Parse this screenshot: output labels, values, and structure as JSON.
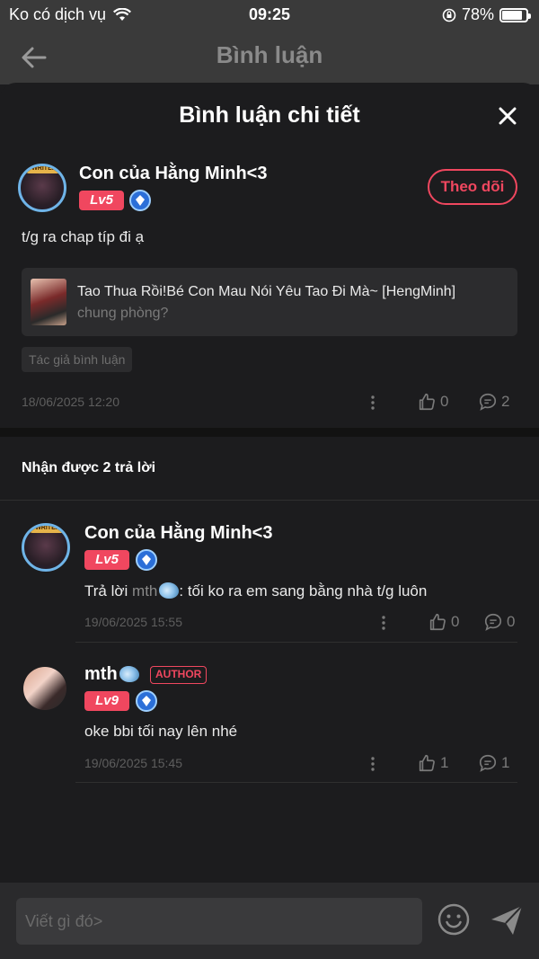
{
  "status_bar": {
    "carrier": "Ko có dịch vụ",
    "time": "09:25",
    "battery": "78%"
  },
  "header": {
    "title": "Bình luận"
  },
  "sheet": {
    "title": "Bình luận chi tiết"
  },
  "comment": {
    "user_name": "Con của Hằng Minh<3",
    "level": "Lv5",
    "follow_label": "Theo dõi",
    "text": "t/g ra chap típ đi ạ",
    "book_title": "Tao Thua Rồi!Bé Con Mau Nói Yêu Tao Đi Mà~ [HengMinh]",
    "book_subtitle": "chung phòng?",
    "tag": "Tác giả bình luận",
    "date": "18/06/2025 12:20",
    "likes": "0",
    "replies": "2"
  },
  "replies_header": "Nhận được 2 trả lời",
  "replies": [
    {
      "user_name": "Con của Hằng Minh<3",
      "level": "Lv5",
      "reply_prefix": "Trả lời ",
      "mention": "mth",
      "text": ": tối ko ra em sang bằng nhà t/g luôn",
      "date": "19/06/2025 15:55",
      "likes": "0",
      "replies": "0"
    },
    {
      "user_name": "mth",
      "author_badge": "AUTHOR",
      "level": "Lv9",
      "text": "oke bbi tối nay lên nhé",
      "date": "19/06/2025 15:45",
      "likes": "1",
      "replies": "1"
    }
  ],
  "composer": {
    "placeholder": "Viết gì đó>"
  },
  "colors": {
    "accent": "#f0475f",
    "background": "#1c1c1e",
    "header": "#3a3a3a"
  }
}
